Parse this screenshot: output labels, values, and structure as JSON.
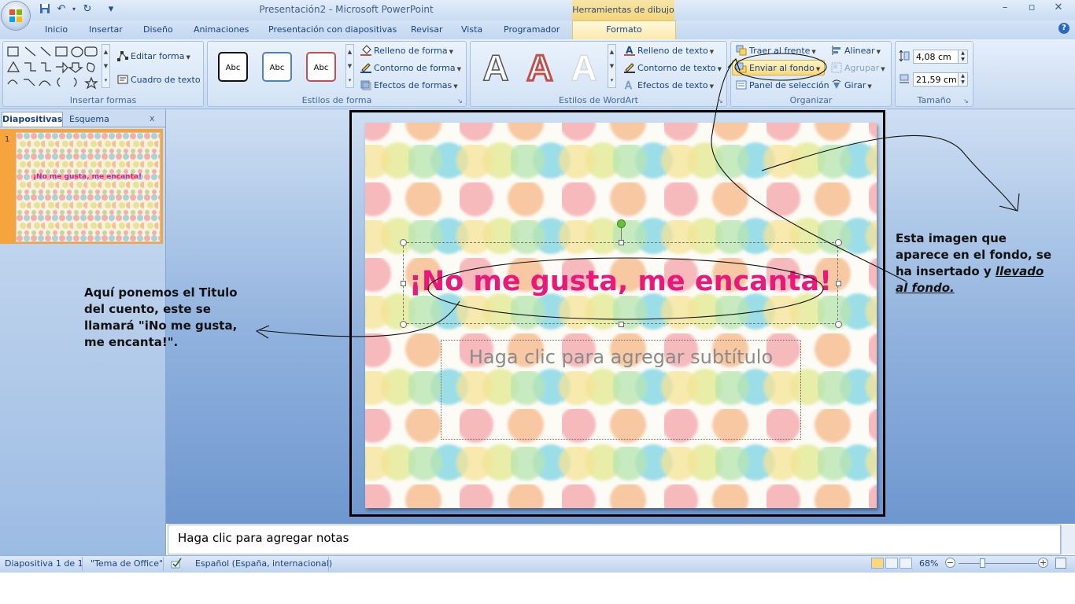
{
  "window": {
    "title": "Presentación2 - Microsoft PowerPoint",
    "context_tab_group": "Herramientas de dibujo",
    "buttons": {
      "minimize": "–",
      "maximize": "▫",
      "close": "✕"
    }
  },
  "quick_access": {
    "save": "save-icon",
    "undo": "↶",
    "redo": "↻",
    "customize": "▾"
  },
  "tabs": [
    "Inicio",
    "Insertar",
    "Diseño",
    "Animaciones",
    "Presentación con diapositivas",
    "Revisar",
    "Vista",
    "Programador"
  ],
  "active_tab": "Formato",
  "ribbon": {
    "insert_shapes": {
      "label": "Insertar formas",
      "edit_shape": "Editar forma",
      "text_box": "Cuadro de texto"
    },
    "shape_styles": {
      "label": "Estilos de forma",
      "swatch_text": "Abc",
      "shape_fill": "Relleno de forma",
      "shape_outline": "Contorno de forma",
      "shape_effects": "Efectos de formas"
    },
    "wordart_styles": {
      "label": "Estilos de WordArt",
      "glyph": "A",
      "text_fill": "Relleno de texto",
      "text_outline": "Contorno de texto",
      "text_effects": "Efectos de texto"
    },
    "arrange": {
      "label": "Organizar",
      "bring_front": "Traer al frente",
      "send_back": "Enviar al fondo",
      "selection_pane": "Panel de selección",
      "align": "Alinear",
      "group": "Agrupar",
      "rotate": "Girar"
    },
    "size": {
      "label": "Tamaño",
      "height": "4,08 cm",
      "width": "21,59 cm"
    }
  },
  "left_pane": {
    "tab_slides": "Diapositivas",
    "tab_outline": "Esquema",
    "close": "x",
    "slide_number": "1",
    "thumb_title": "¡No me gusta, me encanta!"
  },
  "slide": {
    "title": "¡No me gusta, me encanta!",
    "subtitle_placeholder": "Haga clic para agregar subtítulo"
  },
  "annotations": {
    "left": [
      "Aquí ponemos el Titulo",
      "del cuento, este se",
      "llamará \"iNo me gusta,",
      "me encanta!\"."
    ],
    "right_lines": [
      "Esta imagen que",
      "aparece en el fondo, se",
      "ha insertado y "
    ],
    "right_emphasis_1": "llevado",
    "right_emphasis_2": "al fondo."
  },
  "notes": {
    "placeholder": "Haga clic para agregar notas"
  },
  "status": {
    "slide_position": "Diapositiva 1 de 1",
    "theme": "\"Tema de Office\"",
    "language": "Español (España, internacional)",
    "zoom": "68%"
  },
  "colors": {
    "title_pink": "#e8197a",
    "ribbon_blue": "#c7d9f0",
    "highlight_orange": "#f6a43d"
  }
}
